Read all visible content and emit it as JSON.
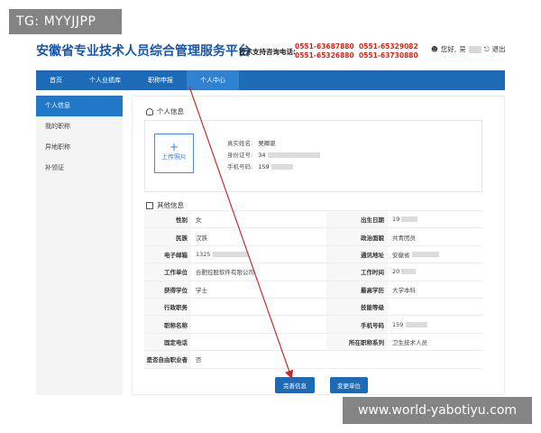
{
  "overlay": {
    "tg_label": "TG: MYYJJPP",
    "watermark": "www.world-yabotiyu.com"
  },
  "header": {
    "site_title": "安徽省专业技术人员综合管理服务平台",
    "hotline_label": "技术支持咨询电话:",
    "hotline_numbers": [
      "0551-63687880",
      "0551-65329082",
      "0551-65326880",
      "0551-63730880"
    ],
    "greeting": "您好,",
    "user_name": "吴",
    "logout": "退出"
  },
  "nav": {
    "items": [
      "首页",
      "个人业绩库",
      "职称申报",
      "个人中心"
    ],
    "active": 3
  },
  "sidebar": {
    "items": [
      "个人信息",
      "我的职称",
      "异地职称",
      "补领证"
    ],
    "active": 0
  },
  "personal": {
    "heading": "个人信息",
    "upload_plus": "+",
    "upload_label": "上传照片",
    "fields": [
      {
        "label": "真实姓名:",
        "value": "吴卿驱"
      },
      {
        "label": "身份证号:",
        "value": "34"
      },
      {
        "label": "手机号码:",
        "value": "159"
      }
    ]
  },
  "other": {
    "heading": "其他信息",
    "rows": [
      [
        "性别",
        "女",
        "出生日期",
        "19"
      ],
      [
        "民族",
        "汉族",
        "政治面貌",
        "共青团员"
      ],
      [
        "电子邮箱",
        "1325",
        "通讯地址",
        "安徽省"
      ],
      [
        "工作单位",
        "合肥控股软件有限公司",
        "工作时间",
        "20"
      ],
      [
        "获得学位",
        "学士",
        "最高学历",
        "大学本科"
      ],
      [
        "行政职务",
        "",
        "技能等级",
        ""
      ],
      [
        "职称名称",
        "",
        "手机号码",
        "159"
      ],
      [
        "固定电话",
        "",
        "所在职称系列",
        "卫生技术人员"
      ],
      [
        "是否自由职业者",
        "否",
        "",
        ""
      ]
    ]
  },
  "buttons": {
    "complete": "完善信息",
    "change_unit": "变更单位"
  },
  "colors": {
    "brand_blue": "#1d6bb6",
    "arrow_red": "#c0302a"
  }
}
